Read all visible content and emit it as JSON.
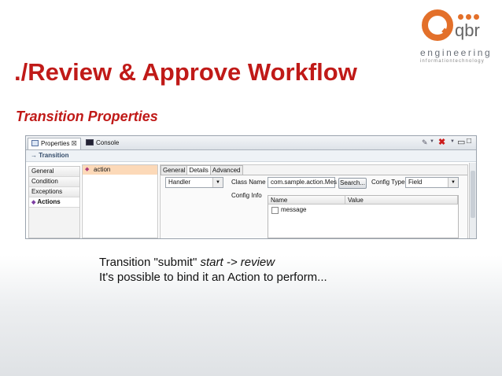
{
  "logo": {
    "brand": "qbr",
    "tagline": "engineering",
    "subtag": "informationtechnology"
  },
  "slide": {
    "title": "./Review & Approve Workflow",
    "subtitle": "Transition Properties"
  },
  "editor": {
    "tabs": [
      {
        "label": "Properties ☒",
        "active": true
      },
      {
        "label": "Console",
        "active": false
      }
    ],
    "section_title": "→ Transition",
    "nav": [
      "General",
      "Condition",
      "Exceptions",
      "Actions"
    ],
    "nav_selected": "Actions",
    "actions": [
      "action"
    ],
    "detail_tabs": [
      "General",
      "Details",
      "Advanced"
    ],
    "detail_active_tab": "Details",
    "handler_value": "Handler",
    "class_name_label": "Class Name",
    "class_name_value": "com.sample.action.Mes",
    "search_button": "Search...",
    "config_type_label": "Config Type",
    "config_type_value": "Field",
    "config_info_label": "Config Info",
    "table": {
      "columns": [
        "Name",
        "Value"
      ],
      "rows": [
        {
          "name": "message",
          "value": ""
        }
      ]
    }
  },
  "description": {
    "line1_prefix": "Transition \"submit\" ",
    "line1_from": "start",
    "line1_arrow": " -> ",
    "line1_to": "review",
    "line2": "It's possible to bind it an Action to perform..."
  },
  "colors": {
    "title": "#c01a18",
    "logo_accent": "#e3702a",
    "selection": "#fcd9b8"
  }
}
